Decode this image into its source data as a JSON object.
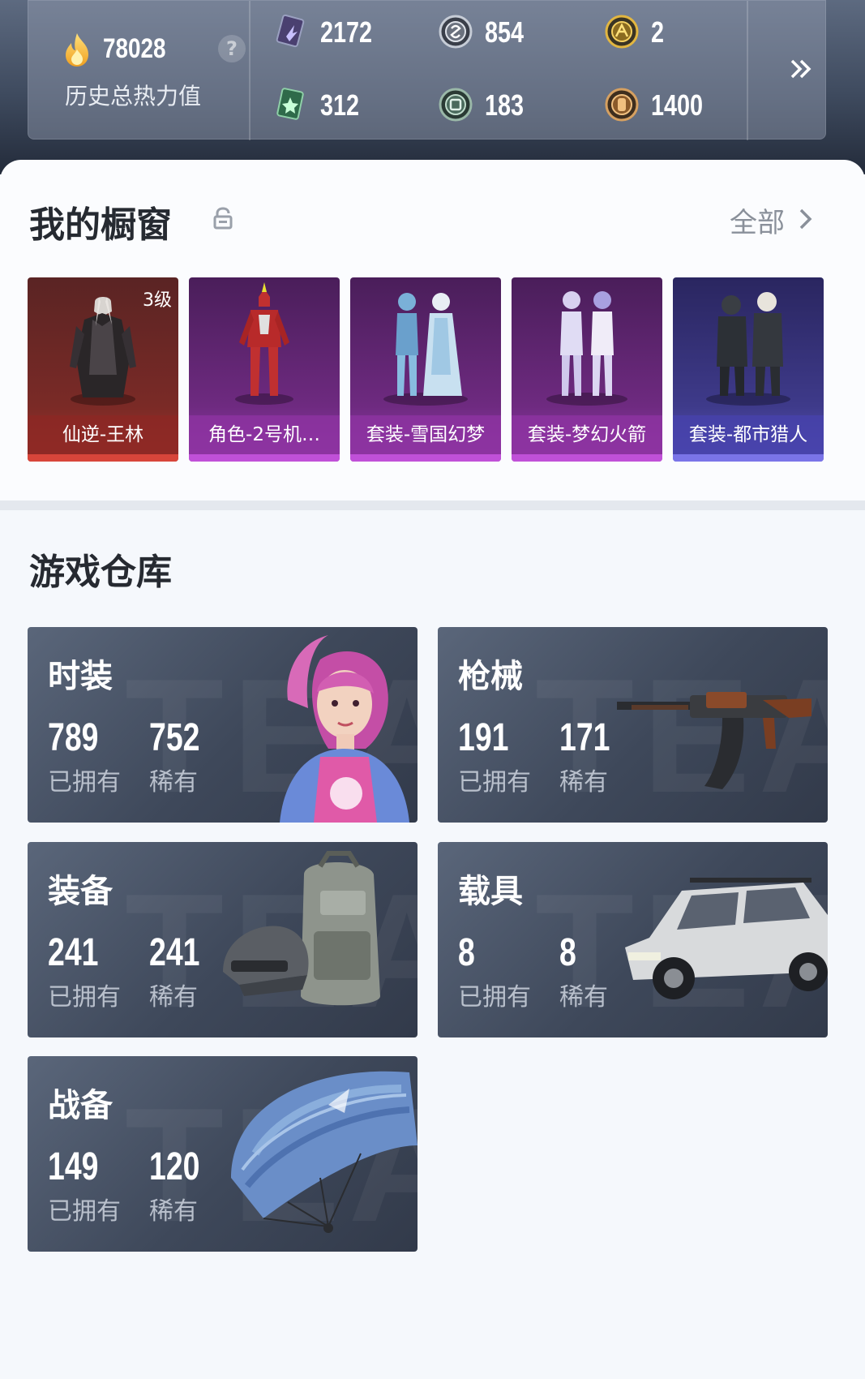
{
  "stats": {
    "heat_value": "78028",
    "heat_help": "?",
    "heat_label": "历史总热力值",
    "currencies": [
      {
        "icon": "purple-card-icon",
        "value": "2172"
      },
      {
        "icon": "silver-coin-icon",
        "value": "854"
      },
      {
        "icon": "gold-coin-icon",
        "value": "2"
      },
      {
        "icon": "green-card-icon",
        "value": "312"
      },
      {
        "icon": "green-coin-icon",
        "value": "183"
      },
      {
        "icon": "bronze-coin-icon",
        "value": "1400"
      }
    ],
    "expand_icon": "double-chevron-right-icon"
  },
  "showcase": {
    "title": "我的橱窗",
    "lock_icon": "lock-icon",
    "view_all": "全部",
    "items": [
      {
        "name": "仙逆-王林",
        "level": "3级",
        "color": "#b2332c"
      },
      {
        "name": "角色-2号机…",
        "color": "#b048c0"
      },
      {
        "name": "套装-雪国幻梦",
        "color": "#b048c0"
      },
      {
        "name": "套装-梦幻火箭",
        "color": "#b048c0"
      },
      {
        "name": "套装-都市猎人",
        "color": "#6a62d6"
      }
    ]
  },
  "warehouse": {
    "title": "游戏仓库",
    "categories": [
      {
        "title": "时装",
        "owned": "789",
        "owned_label": "已拥有",
        "rare": "752",
        "rare_label": "稀有"
      },
      {
        "title": "枪械",
        "owned": "191",
        "owned_label": "已拥有",
        "rare": "171",
        "rare_label": "稀有"
      },
      {
        "title": "装备",
        "owned": "241",
        "owned_label": "已拥有",
        "rare": "241",
        "rare_label": "稀有"
      },
      {
        "title": "载具",
        "owned": "8",
        "owned_label": "已拥有",
        "rare": "8",
        "rare_label": "稀有"
      },
      {
        "title": "战备",
        "owned": "149",
        "owned_label": "已拥有",
        "rare": "120",
        "rare_label": "稀有"
      }
    ]
  },
  "colors": {
    "rare_red": "#b2332c",
    "epic_purple": "#b048c0",
    "legend_violet": "#6a62d6"
  }
}
